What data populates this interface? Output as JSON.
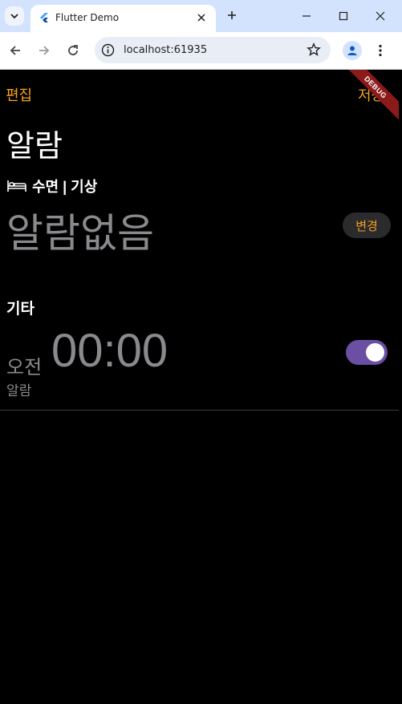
{
  "browser": {
    "tab_title": "Flutter Demo",
    "url": "localhost:61935",
    "icons": {
      "tab_search": "chevron-down-icon",
      "favicon": "flutter-icon",
      "close": "close-icon",
      "new_tab": "plus-icon",
      "back": "back-arrow-icon",
      "forward": "forward-arrow-icon",
      "reload": "reload-icon",
      "site_info": "info-icon",
      "bookmark": "star-icon",
      "profile": "profile-icon",
      "menu": "more-vert-icon"
    }
  },
  "app": {
    "edit_label": "편집",
    "save_label": "저장",
    "debug_banner": "DEBUG",
    "title": "알람",
    "sleep_section": {
      "icon": "bed-icon",
      "label": "수면 | 기상",
      "no_alarm_text": "알람없음",
      "change_label": "변경"
    },
    "other_section": {
      "header": "기타",
      "alarms": [
        {
          "ampm": "오전",
          "time": "00:00",
          "label": "알람",
          "enabled": true
        }
      ]
    },
    "colors": {
      "accent": "#f5a11f",
      "toggle_on": "#6a4fa3",
      "muted_text": "#8a8a8e",
      "debug_banner": "#8b1a1a"
    }
  }
}
